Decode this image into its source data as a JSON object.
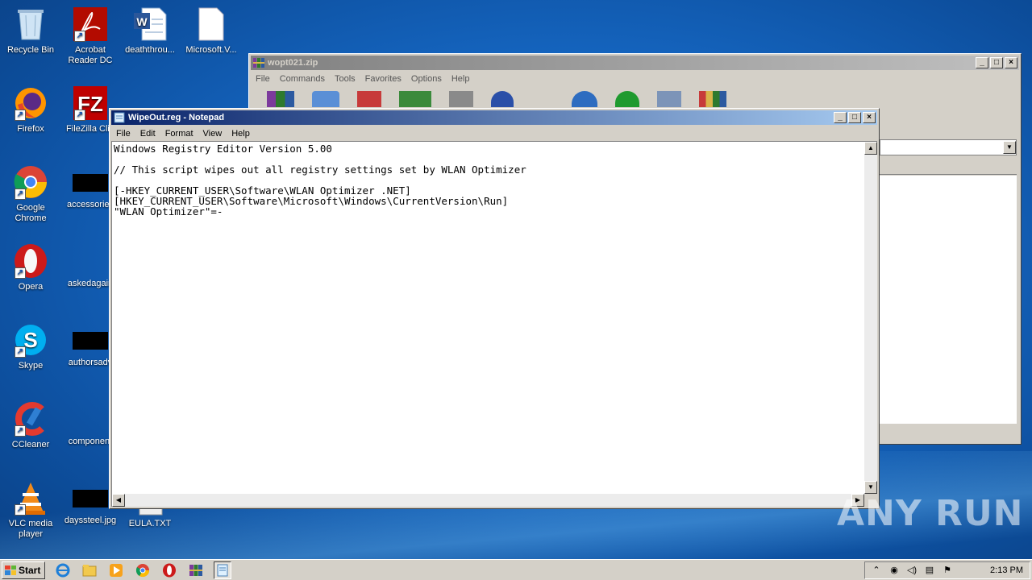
{
  "desktop": {
    "icons": [
      {
        "label": "Recycle Bin",
        "icon": "recycle-bin-icon"
      },
      {
        "label": "Acrobat Reader DC",
        "icon": "acrobat-icon"
      },
      {
        "label": "deaththrou...",
        "icon": "word-doc-icon"
      },
      {
        "label": "Microsoft.V...",
        "icon": "file-icon"
      },
      {
        "label": "Firefox",
        "icon": "firefox-icon"
      },
      {
        "label": "FileZilla Clie",
        "icon": "filezilla-icon"
      },
      {
        "label": "Google Chrome",
        "icon": "chrome-icon"
      },
      {
        "label": "accessories",
        "icon": "redacted-icon"
      },
      {
        "label": "Opera",
        "icon": "opera-icon"
      },
      {
        "label": "askedagain",
        "icon": "redacted-icon"
      },
      {
        "label": "Skype",
        "icon": "skype-icon"
      },
      {
        "label": "authorsadv",
        "icon": "redacted-icon"
      },
      {
        "label": "CCleaner",
        "icon": "ccleaner-icon"
      },
      {
        "label": "component",
        "icon": "redacted-icon"
      },
      {
        "label": "VLC media player",
        "icon": "vlc-icon"
      },
      {
        "label": "dayssteel.jpg",
        "icon": "redacted-icon"
      },
      {
        "label": "EULA.TXT",
        "icon": "text-file-icon"
      }
    ]
  },
  "winrar": {
    "title": "wopt021.zip",
    "menu": [
      "File",
      "Commands",
      "Tools",
      "Favorites",
      "Options",
      "Help"
    ]
  },
  "notepad": {
    "title": "WipeOut.reg - Notepad",
    "menu": [
      "File",
      "Edit",
      "Format",
      "View",
      "Help"
    ],
    "content": "Windows Registry Editor Version 5.00\n\n// This script wipes out all registry settings set by WLAN Optimizer\n\n[-HKEY_CURRENT_USER\\Software\\WLAN Optimizer .NET]\n[HKEY_CURRENT_USER\\Software\\Microsoft\\Windows\\CurrentVersion\\Run]\n\"WLAN Optimizer\"=-"
  },
  "taskbar": {
    "start_label": "Start",
    "clock": "2:13 PM"
  },
  "watermark": {
    "text": "ANY RUN"
  },
  "colors": {
    "title_active": "#0a246a",
    "title_inactive": "#808080",
    "desktop": "#1668c4"
  }
}
